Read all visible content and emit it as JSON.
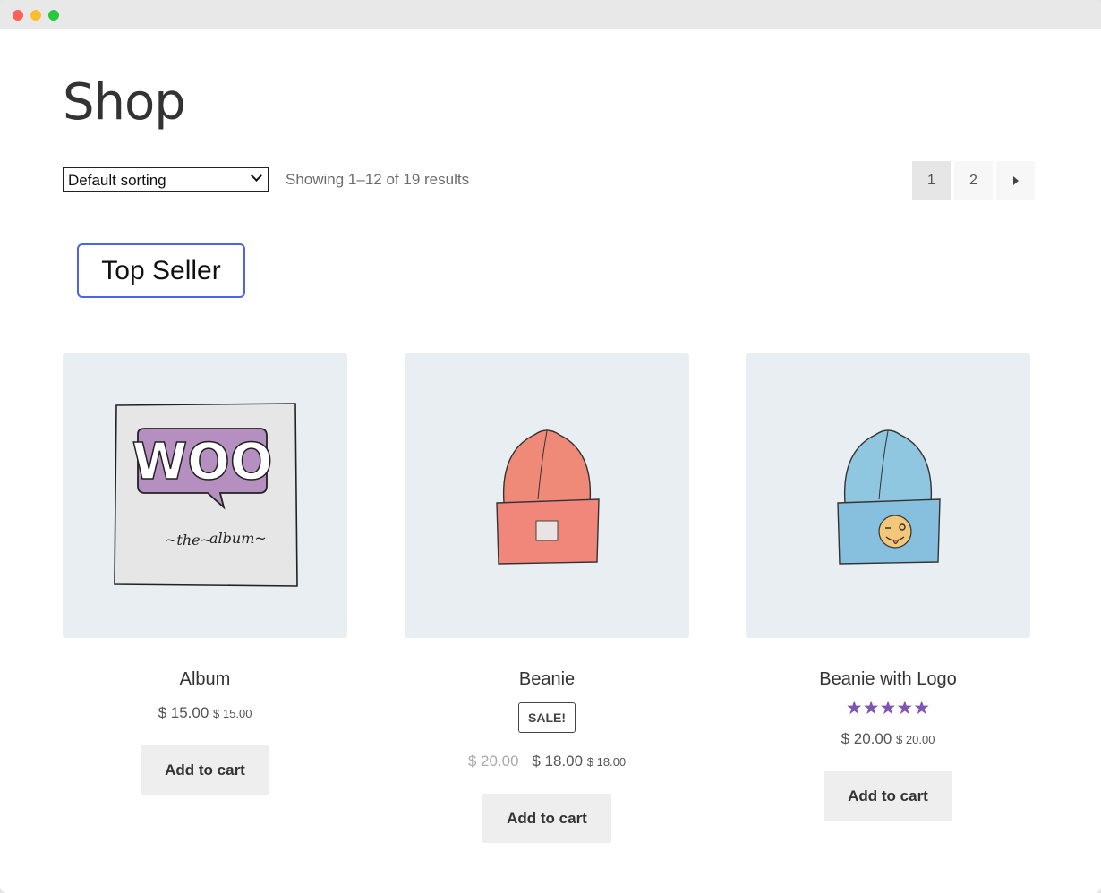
{
  "page": {
    "title": "Shop"
  },
  "toolbar": {
    "sort_selected": "Default sorting",
    "result_count": "Showing 1–12 of 19 results"
  },
  "pagination": {
    "pages": [
      "1",
      "2"
    ],
    "current_page": "1",
    "next_icon": "arrow-right-icon"
  },
  "badge": {
    "label": "Top Seller"
  },
  "products": [
    {
      "name": "Album",
      "price": "$ 15.00",
      "price_small": "$ 15.00",
      "button": "Add to cart"
    },
    {
      "name": "Beanie",
      "sale_label": "SALE!",
      "price_old": "$ 20.00",
      "price": "$ 18.00",
      "price_small": "$ 18.00",
      "button": "Add to cart"
    },
    {
      "name": "Beanie with Logo",
      "rating": 5,
      "stars": "★★★★★",
      "price": "$ 20.00",
      "price_small": "$ 20.00",
      "button": "Add to cart"
    }
  ],
  "colors": {
    "accent": "#7f54b3",
    "focus_border": "#4b65e8",
    "thumb_bg": "#e9eef2"
  }
}
